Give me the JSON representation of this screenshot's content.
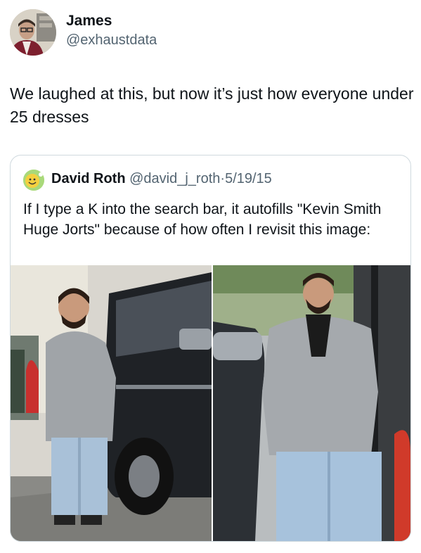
{
  "author": {
    "name": "James",
    "handle": "@exhaustdata",
    "avatar_icon": "user-avatar"
  },
  "tweet": {
    "text": "We laughed at this, but now it’s just how everyone under 25 dresses"
  },
  "quoted": {
    "name": "David Roth",
    "handle": "@david_j_roth",
    "separator": "·",
    "date": "5/19/15",
    "avatar_icon": "smiley-avatar",
    "text": "If I type a K into the search bar, it autofills \"Kevin Smith Huge Jorts\" because of how often I revisit this image:"
  },
  "media": {
    "left_photo": "man-in-jorts-beside-suv-photo",
    "right_photo": "man-in-jorts-at-gas-pump-photo"
  },
  "colors": {
    "text": "#0f1419",
    "secondary": "#536471",
    "border": "#cfd9de"
  }
}
